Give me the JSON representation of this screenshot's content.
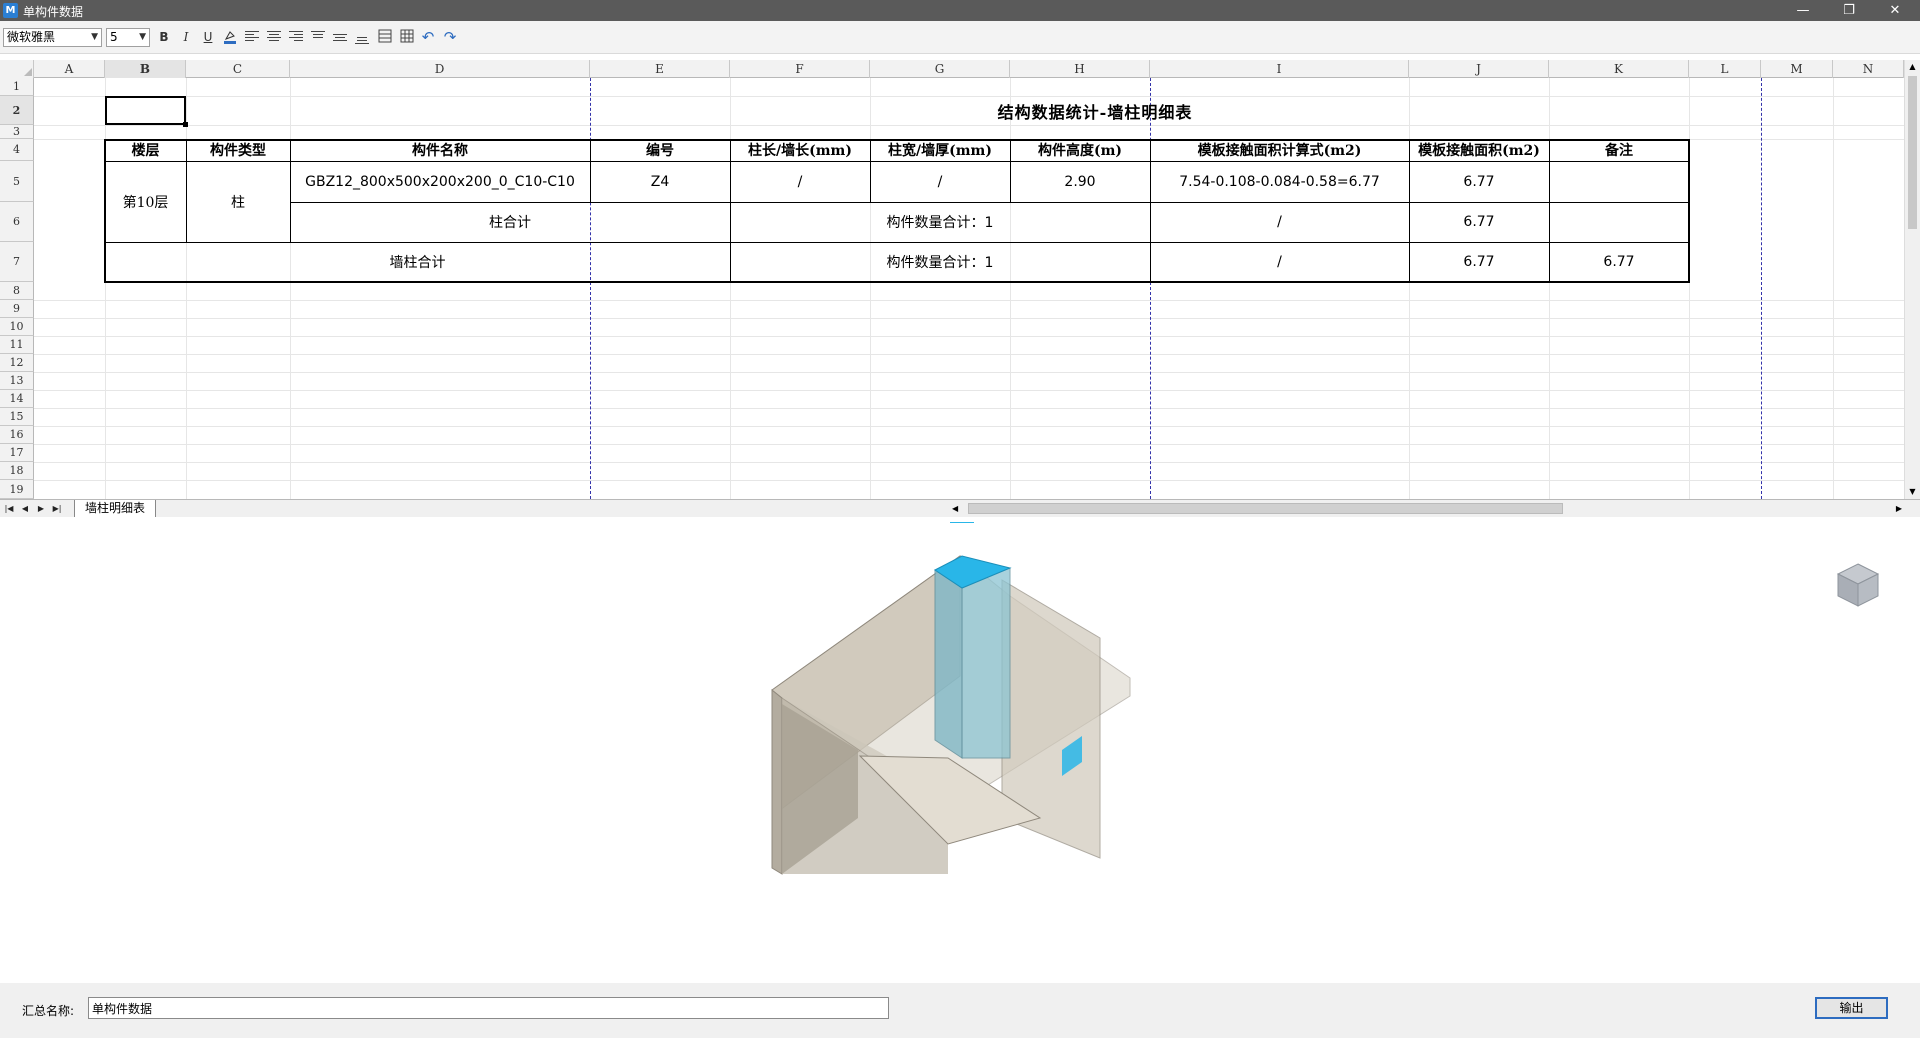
{
  "window": {
    "title": "单构件数据"
  },
  "toolbar": {
    "font_name": "微软雅黑",
    "font_size": "5",
    "bold": "B",
    "italic": "I",
    "underline": "U",
    "icons": [
      "fill-color-icon",
      "align-left-icon",
      "align-center-icon",
      "align-right-icon",
      "align-top-icon",
      "align-middle-icon",
      "align-bottom-icon",
      "merge-cells-icon",
      "grid-icon",
      "undo-icon",
      "redo-icon"
    ]
  },
  "sheet": {
    "columns": [
      "A",
      "B",
      "C",
      "D",
      "E",
      "F",
      "G",
      "H",
      "I",
      "J",
      "K",
      "L",
      "M",
      "N"
    ],
    "rows": [
      "1",
      "2",
      "3",
      "4",
      "5",
      "6",
      "7",
      "8",
      "9",
      "10",
      "11",
      "12",
      "13",
      "14",
      "15",
      "16",
      "17",
      "18",
      "19"
    ],
    "title": "结构数据统计-墙柱明细表",
    "table": {
      "headers": [
        "楼层",
        "构件类型",
        "构件名称",
        "编号",
        "柱长/墙长(mm)",
        "柱宽/墙厚(mm)",
        "构件高度(m)",
        "模板接触面积计算式(m2)",
        "模板接触面积(m2)",
        "备注"
      ],
      "floor": "第10层",
      "type": "柱",
      "name": "GBZ12_800x500x200x200_0_C10-C10",
      "code": "Z4",
      "length": "/",
      "width": "/",
      "height": "2.90",
      "formula": "7.54-0.108-0.084-0.58=6.77",
      "area": "6.77",
      "remark": "",
      "subtotal_label": "柱合计",
      "subtotal_count": "构件数量合计：1",
      "subtotal_formula": "/",
      "subtotal_area": "6.77",
      "total_label": "墙柱合计",
      "total_count": "构件数量合计：1",
      "total_formula": "/",
      "total_area": "6.77",
      "total_remark": "6.77"
    },
    "tab_name": "墙柱明细表"
  },
  "footer": {
    "summary_label": "汇总名称:",
    "summary_value": "单构件数据",
    "export_label": "输出"
  },
  "colors": {
    "titlebar": "#5a5a5a",
    "column_highlight": "#29b6e8",
    "wall": "#c9c2b4",
    "accent": "#2d6cc0"
  }
}
